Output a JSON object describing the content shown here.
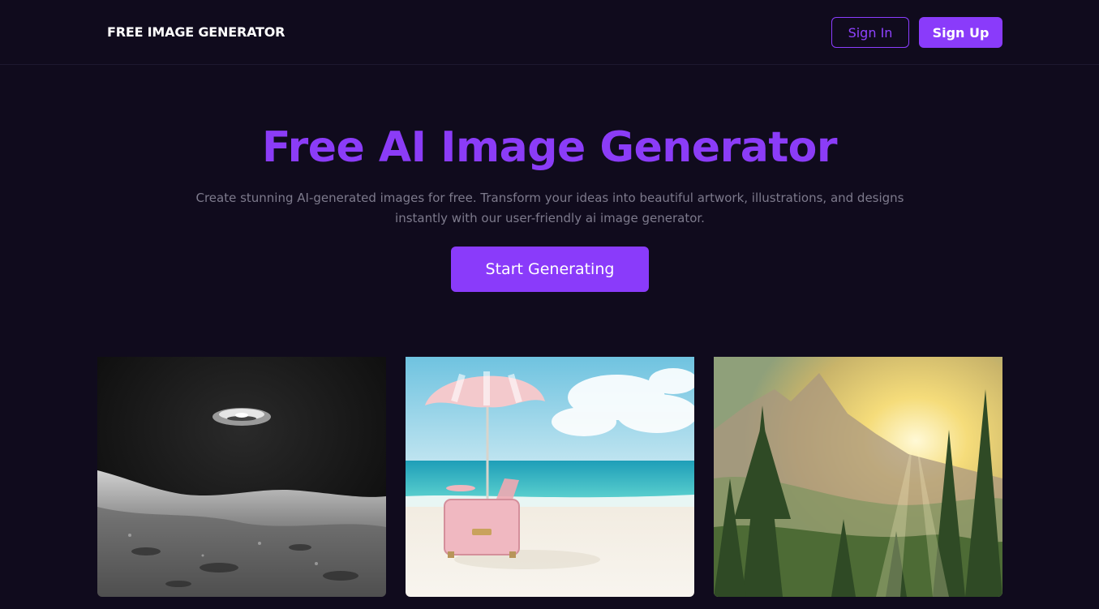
{
  "header": {
    "brand": "FREE IMAGE GENERATOR",
    "sign_in_label": "Sign In",
    "sign_up_label": "Sign Up"
  },
  "hero": {
    "title": "Free AI Image Generator",
    "subtitle": "Create stunning AI-generated images for free. Transform your ideas into beautiful artwork, illustrations, and designs instantly with our user-friendly ai image generator.",
    "cta_label": "Start Generating"
  },
  "gallery": [
    {
      "subject": "ufo-over-moon-surface"
    },
    {
      "subject": "beach-umbrella-pink-suitcase"
    },
    {
      "subject": "sunlit-forest-mountains"
    }
  ],
  "colors": {
    "background": "#100b1d",
    "accent": "#8a3bfa",
    "muted_text": "#7d7a8c"
  }
}
